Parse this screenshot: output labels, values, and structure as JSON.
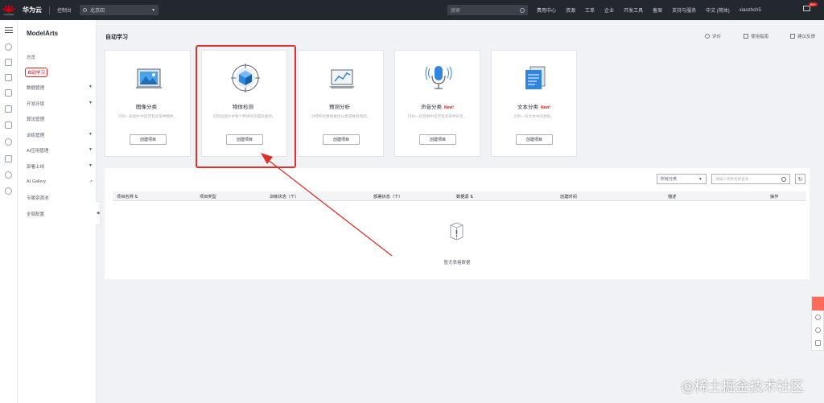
{
  "topbar": {
    "logo_text": "HUAWEI",
    "brand": "华为云",
    "console": "控制台",
    "region": "北京四",
    "search_placeholder": "搜索",
    "links": [
      "费用中心",
      "资源",
      "工单",
      "企业",
      "开发工具",
      "备案",
      "支持与服务",
      "中文 (简体)",
      "xiaozhch5"
    ],
    "badge": "99+",
    "colors": {
      "background": "#23272e",
      "accent": "#c7000b"
    }
  },
  "sidebar": {
    "title": "ModelArts",
    "items": [
      {
        "label": "总览",
        "has_arrow": false
      },
      {
        "label": "自动学习",
        "has_arrow": false,
        "active": true
      },
      {
        "label": "数据管理",
        "has_arrow": true
      },
      {
        "label": "开发环境",
        "has_arrow": true
      },
      {
        "label": "算法管理",
        "has_arrow": false
      },
      {
        "label": "训练管理",
        "has_arrow": true
      },
      {
        "label": "AI应用管理",
        "has_arrow": true
      },
      {
        "label": "部署上线",
        "has_arrow": true
      },
      {
        "label": "AI Gallery",
        "has_arrow": false,
        "external": true
      },
      {
        "label": "专属资源池",
        "has_arrow": false
      },
      {
        "label": "全局配置",
        "has_arrow": false
      }
    ]
  },
  "main": {
    "title": "自动学习",
    "tools": {
      "rate": "评价",
      "guide": "使用指南",
      "feedback": "建议反馈"
    },
    "cards": [
      {
        "name": "图像分类",
        "new": "",
        "desc": "识别一张图片中是否包含某种物体。",
        "button": "创建项目",
        "icon": "image-classification-icon"
      },
      {
        "name": "物体检测",
        "new": "",
        "desc": "识别出图片中每个物体的位置及类别。",
        "button": "创建项目",
        "icon": "object-detection-icon"
      },
      {
        "name": "预测分析",
        "new": "",
        "desc": "对结构化数据做出分类或数值预测。",
        "button": "创建项目",
        "icon": "predictive-analytics-icon"
      },
      {
        "name": "声音分类",
        "new": "New!",
        "desc": "识别一段音频中是否包含某种声音。",
        "button": "创建项目",
        "icon": "sound-classification-icon"
      },
      {
        "name": "文本分类",
        "new": "New!",
        "desc": "识别一段文本中的类别。",
        "button": "创建项目",
        "icon": "text-classification-icon"
      }
    ]
  },
  "table": {
    "filter": "所有分类",
    "search_placeholder": "请输入项目名称查询",
    "refresh_glyph": "↻",
    "sort_glyph": "⇅",
    "columns": [
      "项目名称",
      "项目类型",
      "训练状态（个）",
      "部署状态（个）",
      "数据源",
      "创建时间",
      "描述",
      "操作"
    ],
    "empty_text": "暂无表格数据"
  },
  "watermark": "@稀土掘金技术社区"
}
